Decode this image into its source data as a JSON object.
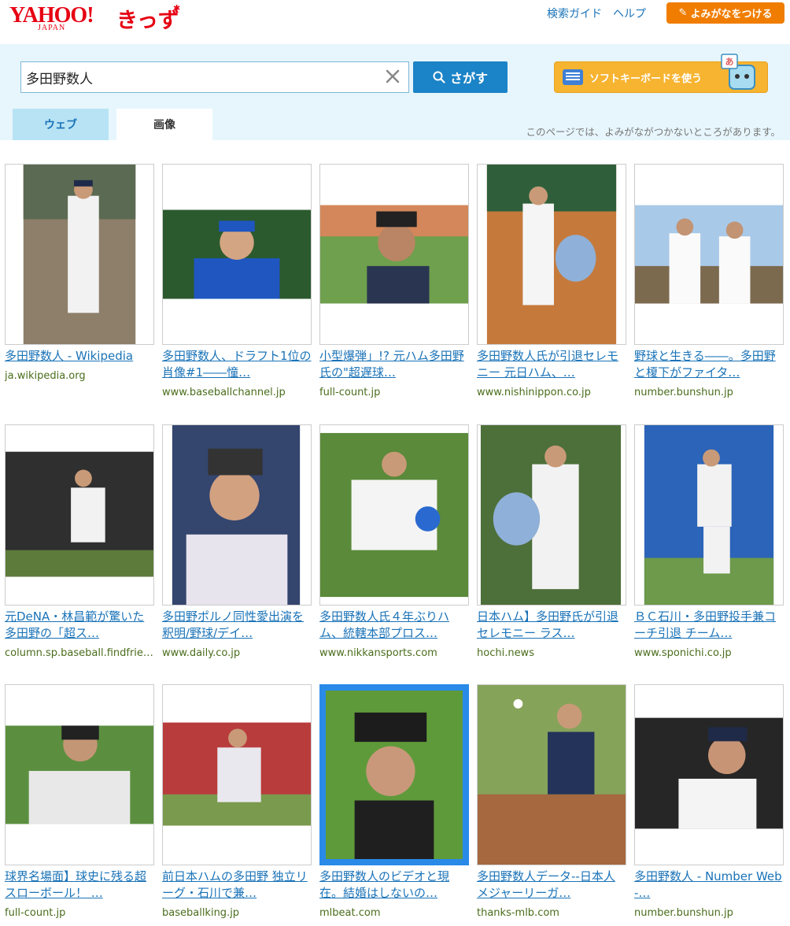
{
  "header": {
    "logo_main": "YAHOO!",
    "logo_sub": "JAPAN",
    "logo_kids": "きっず",
    "links": [
      "検索ガイド",
      "ヘルプ"
    ],
    "yomigana_button": "よみがなをつける"
  },
  "search": {
    "query": "多田野数人",
    "button_label": "さがす",
    "soft_keyboard_label": "ソフトキーボードを使う",
    "mascot_letter": "あ"
  },
  "tabs": [
    {
      "label": "ウェブ",
      "active": false
    },
    {
      "label": "画像",
      "active": true
    }
  ],
  "notice": "このページでは、よみがながつかないところがあります。",
  "results": [
    {
      "title": "多田野数人 - Wikipedia",
      "domain": "ja.wikipedia.org"
    },
    {
      "title": "多田野数人、ドラフト1位の肖像#1――憧…",
      "domain": "www.baseballchannel.jp"
    },
    {
      "title": "小型爆弾」!? 元ハム多田野氏の\"超遅球…",
      "domain": "full-count.jp"
    },
    {
      "title": "多田野数人氏が引退セレモニー 元日ハム、…",
      "domain": "www.nishinippon.co.jp"
    },
    {
      "title": "野球と生きる――。多田野と榎下がファイタ…",
      "domain": "number.bunshun.jp"
    },
    {
      "title": "元DeNA・林昌範が驚いた多田野の「超ス…",
      "domain": "column.sp.baseball.findfriends.jp"
    },
    {
      "title": "多田野ポルノ同性愛出演を釈明/野球/デイ…",
      "domain": "www.daily.co.jp"
    },
    {
      "title": "多田野数人氏４年ぶりハム、統轄本部プロス…",
      "domain": "www.nikkansports.com"
    },
    {
      "title": "日本ハム】多田野氏が引退セレモニー ラス…",
      "domain": "hochi.news"
    },
    {
      "title": "ＢＣ石川・多田野投手兼コーチ引退 チーム…",
      "domain": "www.sponichi.co.jp"
    },
    {
      "title": "球界名場面】球史に残る超スローボール！ …",
      "domain": "full-count.jp"
    },
    {
      "title": "前日本ハムの多田野 独立リーグ・石川で兼…",
      "domain": "baseballking.jp"
    },
    {
      "title": "多田野数人のビデオと現在。結婚はしないの…",
      "domain": "mlbeat.com"
    },
    {
      "title": "多田野数人データ--日本人メジャーリーガ…",
      "domain": "thanks-mlb.com"
    },
    {
      "title": "多田野数人 - Number Web -…",
      "domain": "number.bunshun.jp"
    }
  ],
  "colors": {
    "accent": "#1b83c7",
    "link": "#1a73b8",
    "domain": "#4a6d1c",
    "band": "#e7f6fd",
    "orange": "#f07d00"
  }
}
